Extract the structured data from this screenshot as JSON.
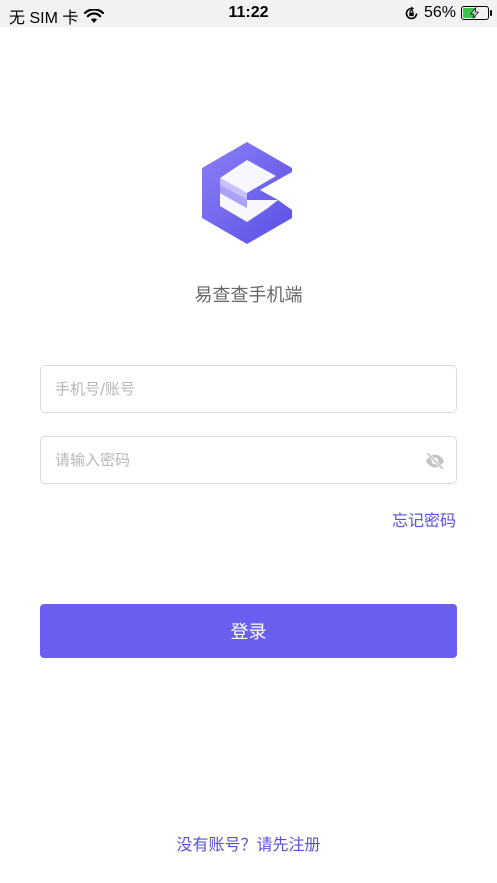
{
  "status_bar": {
    "carrier": "无 SIM 卡",
    "time": "11:22",
    "battery_percent": "56%",
    "battery_level": 0.56
  },
  "app": {
    "name": "易查查手机端",
    "logo_icon": "e-hexagon-logo-icon"
  },
  "login_form": {
    "account_placeholder": "手机号/账号",
    "account_value": "",
    "password_placeholder": "请输入密码",
    "password_value": "",
    "forgot_password": "忘记密码",
    "login_button": "登录"
  },
  "footer": {
    "no_account_text": "没有账号？请先注册"
  },
  "colors": {
    "accent": "#6a5ff1",
    "link": "#5a50e0",
    "battery": "#3cc34a"
  }
}
